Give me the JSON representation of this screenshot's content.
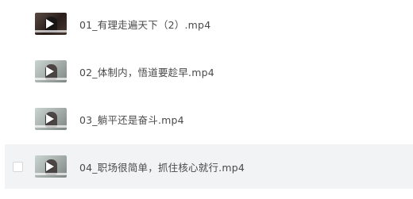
{
  "files": [
    {
      "name": "01_有理走遍天下（2）.mp4",
      "thumbnail": "video-thumbnail-dark",
      "selected": false
    },
    {
      "name": "02_体制内，悟道要趁早.mp4",
      "thumbnail": "video-thumbnail",
      "selected": false
    },
    {
      "name": "03_躺平还是奋斗.mp4",
      "thumbnail": "video-thumbnail",
      "selected": false
    },
    {
      "name": "04_职场很简单，抓住核心就行.mp4",
      "thumbnail": "video-thumbnail",
      "selected": true
    }
  ],
  "icons": {
    "play": "play-icon",
    "checkbox": "checkbox-icon"
  },
  "colors": {
    "selected_row_bg": "#f2f3f5",
    "text": "#4a4a4a"
  }
}
